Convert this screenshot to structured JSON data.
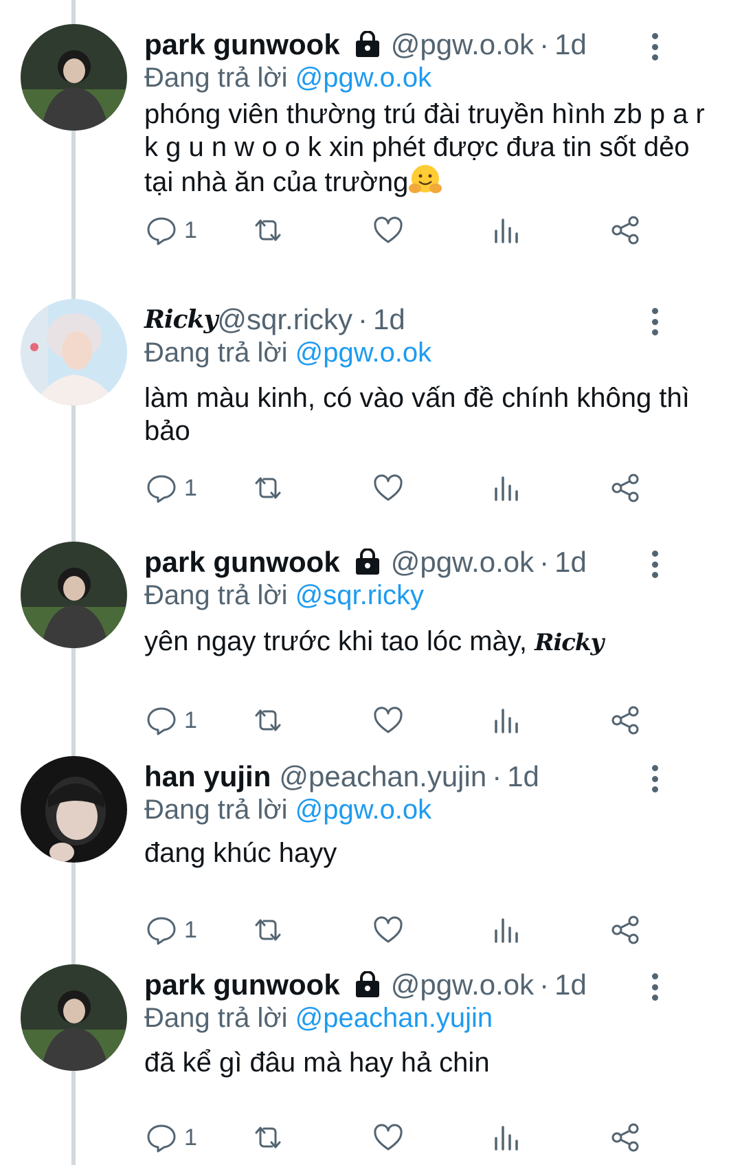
{
  "tweets": [
    {
      "author": "park gunwook",
      "locked": true,
      "handle": "@pgw.o.ok",
      "sep": "·",
      "time": "1d",
      "reply_prefix": "Đang trả lời",
      "reply_to": "@pgw.o.ok",
      "text": "phóng viên thường trú đài truyền hình zb p a r k g u n w o o k xin phét được đưa tin sốt dẻo tại nhà ăn của trường",
      "emoji": "hugging-face",
      "reply_count": "1"
    },
    {
      "author": "Ricky",
      "locked": false,
      "handle": "@sqr.ricky",
      "sep": "·",
      "time": "1d",
      "reply_prefix": "Đang trả lời",
      "reply_to": "@pgw.o.ok",
      "text": "làm màu kinh, có vào vấn đề chính không thì bảo",
      "reply_count": "1"
    },
    {
      "author": "park gunwook",
      "locked": true,
      "handle": "@pgw.o.ok",
      "sep": "·",
      "time": "1d",
      "reply_prefix": "Đang trả lời",
      "reply_to": "@sqr.ricky",
      "text": "yên ngay trước khi tao lóc mày,",
      "text_suffix": "Ricky",
      "reply_count": "1"
    },
    {
      "author": "han yujin",
      "locked": false,
      "handle": "@peachan.yujin",
      "sep": "·",
      "time": "1d",
      "reply_prefix": "Đang trả lời",
      "reply_to": "@pgw.o.ok",
      "text": "đang khúc hayy",
      "reply_count": "1"
    },
    {
      "author": "park gunwook",
      "locked": true,
      "handle": "@pgw.o.ok",
      "sep": "·",
      "time": "1d",
      "reply_prefix": "Đang trả lời",
      "reply_to": "@peachan.yujin",
      "text": "đã kể gì đâu mà hay hả chin",
      "reply_count": "1"
    }
  ],
  "icons": {
    "reply": "reply-icon",
    "retweet": "retweet-icon",
    "like": "heart-icon",
    "views": "views-icon",
    "share": "share-icon",
    "more": "more-options-icon",
    "lock": "lock-icon"
  },
  "colors": {
    "text": "#0f1419",
    "secondary": "#536471",
    "mention": "#1d9bf0",
    "thread_line": "#cfd9de"
  }
}
